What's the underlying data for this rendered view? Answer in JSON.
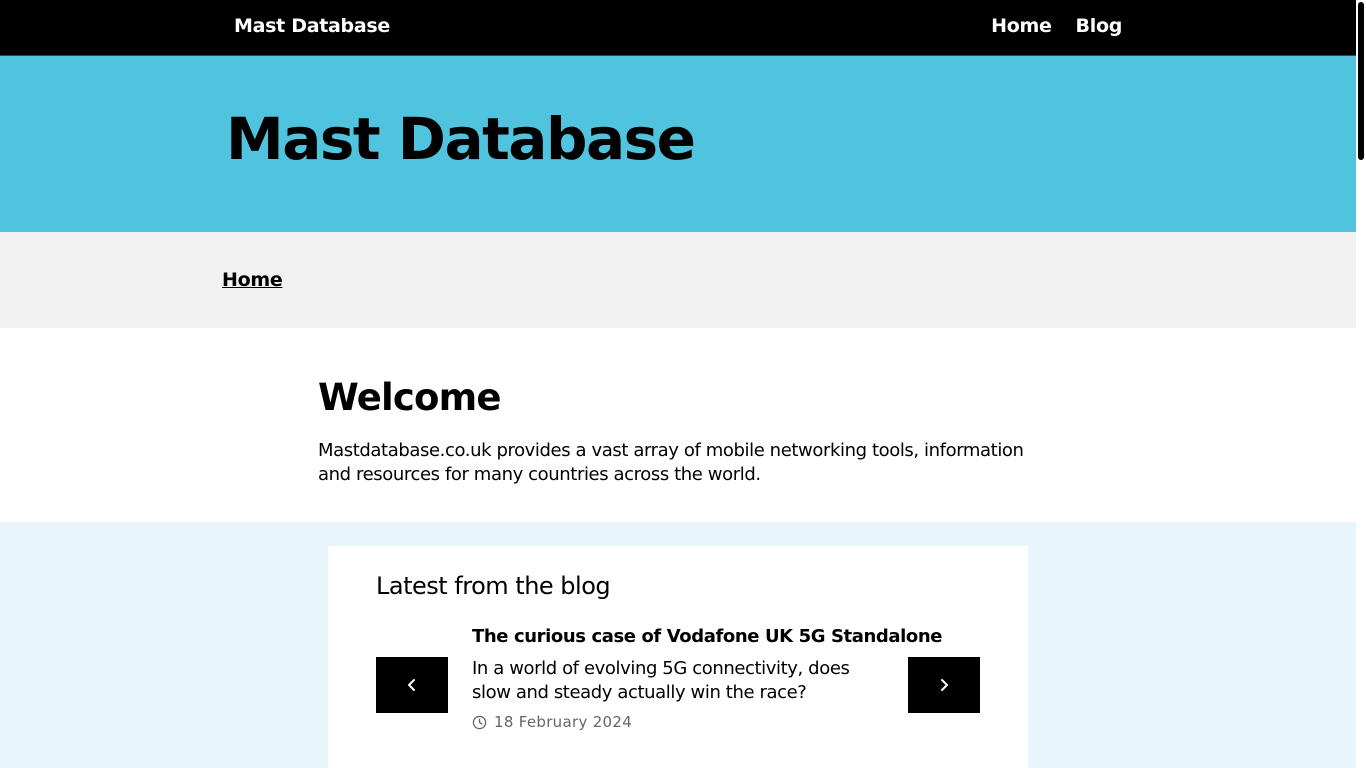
{
  "header": {
    "site_title": "Mast Database",
    "nav": [
      {
        "label": "Home"
      },
      {
        "label": "Blog"
      }
    ]
  },
  "hero": {
    "title": "Mast Database"
  },
  "breadcrumb": {
    "home": "Home"
  },
  "welcome": {
    "heading": "Welcome",
    "text": "Mastdatabase.co.uk provides a vast array of mobile networking tools, information and resources for many countries across the world."
  },
  "blog": {
    "heading": "Latest from the blog",
    "post": {
      "title": "The curious case of Vodafone UK 5G Standalone",
      "excerpt": "In a world of evolving 5G connectivity, does slow and steady actually win the race?",
      "date": "18 February 2024"
    }
  },
  "colors": {
    "topbar": "#000000",
    "hero": "#50c4df",
    "breadcrumb_bg": "#f1f1f1",
    "blog_section_bg": "#e6f6fa"
  },
  "icons": {
    "prev": "chevron-left-icon",
    "next": "chevron-right-icon",
    "date": "clock-icon"
  }
}
